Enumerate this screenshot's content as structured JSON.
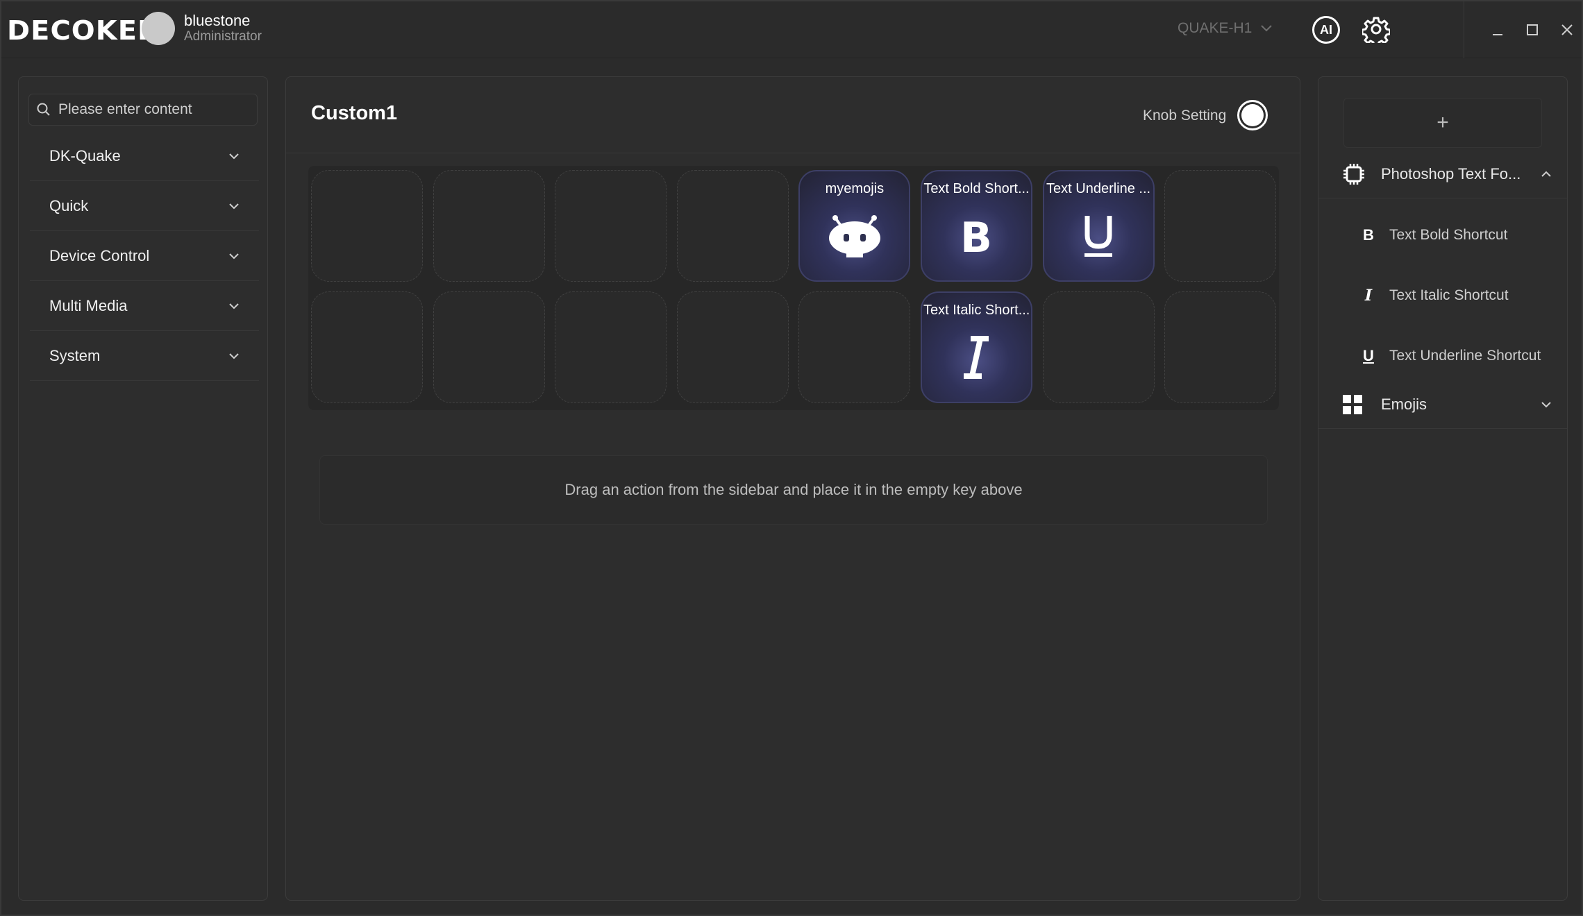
{
  "app": {
    "logo_text": "DECOKEE",
    "user": {
      "name": "bluestone",
      "role": "Administrator"
    },
    "device_select": {
      "selected": "QUAKE-H1"
    },
    "ai_label": "AI"
  },
  "sidebar": {
    "search_placeholder": "Please enter content",
    "categories": [
      {
        "label": "DK-Quake"
      },
      {
        "label": "Quick"
      },
      {
        "label": "Device Control"
      },
      {
        "label": "Multi Media"
      },
      {
        "label": "System"
      }
    ]
  },
  "main": {
    "title": "Custom1",
    "knob_setting_label": "Knob Setting",
    "keys": [
      {
        "label": ""
      },
      {
        "label": ""
      },
      {
        "label": ""
      },
      {
        "label": ""
      },
      {
        "label": "myemojis",
        "icon": "robot-icon"
      },
      {
        "label": "Text Bold Short...",
        "icon": "bold-icon"
      },
      {
        "label": "Text Underline ...",
        "icon": "underline-icon"
      },
      {
        "label": ""
      },
      {
        "label": ""
      },
      {
        "label": ""
      },
      {
        "label": ""
      },
      {
        "label": ""
      },
      {
        "label": ""
      },
      {
        "label": "Text Italic Short...",
        "icon": "italic-icon"
      },
      {
        "label": ""
      },
      {
        "label": ""
      }
    ],
    "hint": "Drag an action from the sidebar and place it in the empty key above"
  },
  "actions_panel": {
    "add_label": "+",
    "groups": [
      {
        "label": "Photoshop Text Fo...",
        "icon": "chip-icon",
        "expanded": true,
        "items": [
          {
            "label": "Text Bold Shortcut",
            "icon": "bold-icon",
            "glyph": "B"
          },
          {
            "label": "Text Italic Shortcut",
            "icon": "italic-icon",
            "glyph": "I"
          },
          {
            "label": "Text Underline Shortcut",
            "icon": "underline-icon",
            "glyph": "U"
          }
        ]
      },
      {
        "label": "Emojis",
        "icon": "grid-icon",
        "expanded": false
      }
    ]
  },
  "colors": {
    "background": "#2b2b2b",
    "panel": "#2d2d2d",
    "key_filled_glow": "#4b4e84",
    "text_primary": "#ffffff",
    "text_muted": "#6f6f6f"
  }
}
